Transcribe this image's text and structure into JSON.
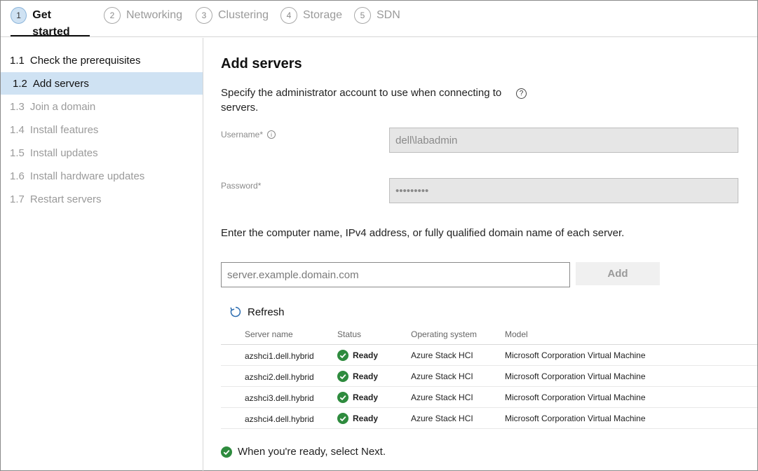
{
  "stepper": {
    "steps": [
      {
        "num": "1",
        "label": "Get started"
      },
      {
        "num": "2",
        "label": "Networking"
      },
      {
        "num": "3",
        "label": "Clustering"
      },
      {
        "num": "4",
        "label": "Storage"
      },
      {
        "num": "5",
        "label": "SDN"
      }
    ]
  },
  "sidebar": {
    "items": [
      {
        "num": "1.1",
        "label": "Check the prerequisites"
      },
      {
        "num": "1.2",
        "label": "Add servers"
      },
      {
        "num": "1.3",
        "label": "Join a domain"
      },
      {
        "num": "1.4",
        "label": "Install features"
      },
      {
        "num": "1.5",
        "label": "Install updates"
      },
      {
        "num": "1.6",
        "label": "Install hardware updates"
      },
      {
        "num": "1.7",
        "label": "Restart servers"
      }
    ]
  },
  "main": {
    "title": "Add servers",
    "description": "Specify the administrator account to use when connecting to servers.",
    "help_icon": "?",
    "username": {
      "label": "Username",
      "required_mark": "*",
      "info_icon": "i",
      "value": "dell\\labadmin"
    },
    "password": {
      "label": "Password",
      "required_mark": "*",
      "value": "•••••••••"
    },
    "instruction": "Enter the computer name, IPv4 address, or fully qualified domain name of each server.",
    "server_input": {
      "placeholder": "server.example.domain.com",
      "value": ""
    },
    "add_label": "Add",
    "refresh_label": "Refresh",
    "table": {
      "headers": [
        "Server name",
        "Status",
        "Operating system",
        "Model"
      ],
      "rows": [
        {
          "name": "azshci1.dell.hybrid",
          "status": "Ready",
          "os": "Azure Stack HCI",
          "model": "Microsoft Corporation Virtual Machine"
        },
        {
          "name": "azshci2.dell.hybrid",
          "status": "Ready",
          "os": "Azure Stack HCI",
          "model": "Microsoft Corporation Virtual Machine"
        },
        {
          "name": "azshci3.dell.hybrid",
          "status": "Ready",
          "os": "Azure Stack HCI",
          "model": "Microsoft Corporation Virtual Machine"
        },
        {
          "name": "azshci4.dell.hybrid",
          "status": "Ready",
          "os": "Azure Stack HCI",
          "model": "Microsoft Corporation Virtual Machine"
        }
      ]
    },
    "footer_message": "When you're ready, select Next."
  },
  "colors": {
    "accent_highlight": "#cfe2f3",
    "success_green": "#2e8b3e"
  },
  "icons": {
    "help": "question-circle-icon",
    "info": "info-circle-icon",
    "refresh": "refresh-icon",
    "status_ok": "check-circle-icon"
  }
}
